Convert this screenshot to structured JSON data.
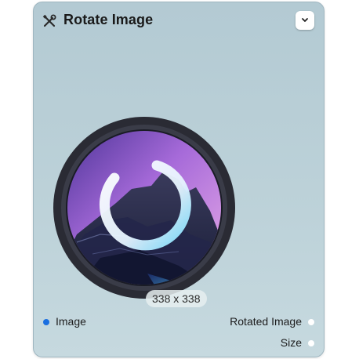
{
  "node": {
    "title": "Rotate Image",
    "header_icon": "tools-icon",
    "collapse_icon": "chevron-down-icon"
  },
  "preview": {
    "size_label": "338 x 338",
    "loading_icon": "spinner-icon"
  },
  "ports": {
    "inputs": [
      {
        "label": "Image",
        "color": "#1a6fe0"
      }
    ],
    "outputs": [
      {
        "label": "Rotated Image",
        "color": "#ffffff"
      },
      {
        "label": "Size",
        "color": "#ffffff"
      }
    ]
  },
  "colors": {
    "card_background": "#b8ced6",
    "accent": "#1a6fe0"
  }
}
